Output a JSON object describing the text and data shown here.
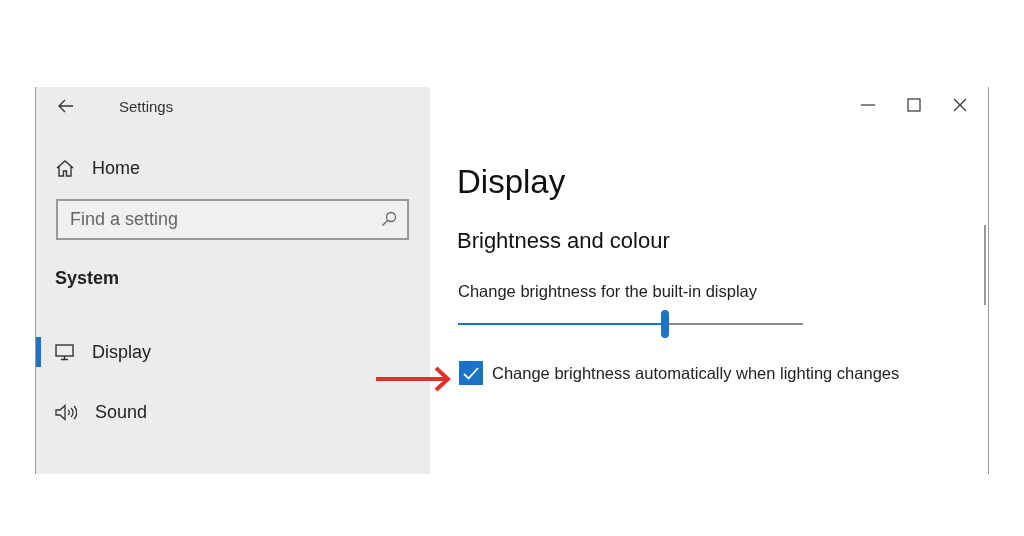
{
  "window": {
    "title": "Settings"
  },
  "sidebar": {
    "home": "Home",
    "search": {
      "placeholder": "Find a setting"
    },
    "section": "System",
    "items": [
      {
        "label": "Display",
        "kind": "monitor",
        "selected": true
      },
      {
        "label": "Sound",
        "kind": "speaker",
        "selected": false
      }
    ]
  },
  "content": {
    "title": "Display",
    "section": "Brightness and colour",
    "slider": {
      "label": "Change brightness for the built-in display",
      "level": 0.6
    },
    "checkbox": {
      "label": "Change brightness automatically when lighting changes",
      "checked": true
    }
  }
}
